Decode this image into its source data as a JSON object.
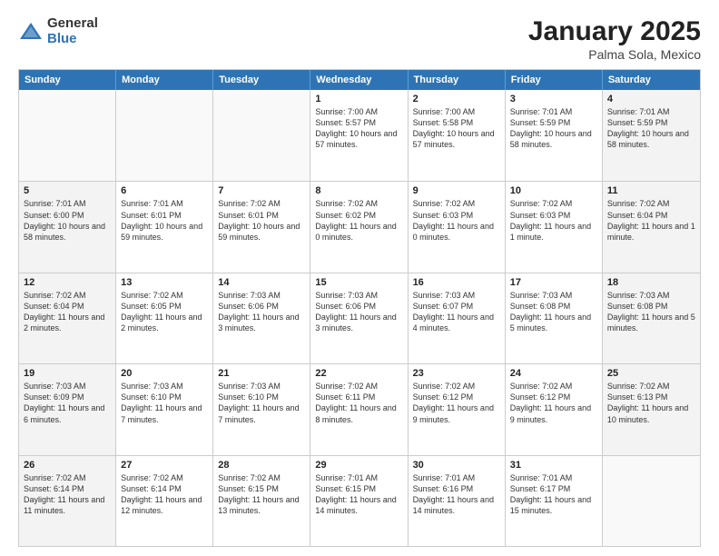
{
  "logo": {
    "general": "General",
    "blue": "Blue"
  },
  "title": "January 2025",
  "subtitle": "Palma Sola, Mexico",
  "header_days": [
    "Sunday",
    "Monday",
    "Tuesday",
    "Wednesday",
    "Thursday",
    "Friday",
    "Saturday"
  ],
  "rows": [
    [
      {
        "day": "",
        "info": "",
        "empty": true
      },
      {
        "day": "",
        "info": "",
        "empty": true
      },
      {
        "day": "",
        "info": "",
        "empty": true
      },
      {
        "day": "1",
        "info": "Sunrise: 7:00 AM\nSunset: 5:57 PM\nDaylight: 10 hours\nand 57 minutes."
      },
      {
        "day": "2",
        "info": "Sunrise: 7:00 AM\nSunset: 5:58 PM\nDaylight: 10 hours\nand 57 minutes."
      },
      {
        "day": "3",
        "info": "Sunrise: 7:01 AM\nSunset: 5:59 PM\nDaylight: 10 hours\nand 58 minutes."
      },
      {
        "day": "4",
        "info": "Sunrise: 7:01 AM\nSunset: 5:59 PM\nDaylight: 10 hours\nand 58 minutes.",
        "shaded": true
      }
    ],
    [
      {
        "day": "5",
        "info": "Sunrise: 7:01 AM\nSunset: 6:00 PM\nDaylight: 10 hours\nand 58 minutes.",
        "shaded": true
      },
      {
        "day": "6",
        "info": "Sunrise: 7:01 AM\nSunset: 6:01 PM\nDaylight: 10 hours\nand 59 minutes."
      },
      {
        "day": "7",
        "info": "Sunrise: 7:02 AM\nSunset: 6:01 PM\nDaylight: 10 hours\nand 59 minutes."
      },
      {
        "day": "8",
        "info": "Sunrise: 7:02 AM\nSunset: 6:02 PM\nDaylight: 11 hours\nand 0 minutes."
      },
      {
        "day": "9",
        "info": "Sunrise: 7:02 AM\nSunset: 6:03 PM\nDaylight: 11 hours\nand 0 minutes."
      },
      {
        "day": "10",
        "info": "Sunrise: 7:02 AM\nSunset: 6:03 PM\nDaylight: 11 hours\nand 1 minute."
      },
      {
        "day": "11",
        "info": "Sunrise: 7:02 AM\nSunset: 6:04 PM\nDaylight: 11 hours\nand 1 minute.",
        "shaded": true
      }
    ],
    [
      {
        "day": "12",
        "info": "Sunrise: 7:02 AM\nSunset: 6:04 PM\nDaylight: 11 hours\nand 2 minutes.",
        "shaded": true
      },
      {
        "day": "13",
        "info": "Sunrise: 7:02 AM\nSunset: 6:05 PM\nDaylight: 11 hours\nand 2 minutes."
      },
      {
        "day": "14",
        "info": "Sunrise: 7:03 AM\nSunset: 6:06 PM\nDaylight: 11 hours\nand 3 minutes."
      },
      {
        "day": "15",
        "info": "Sunrise: 7:03 AM\nSunset: 6:06 PM\nDaylight: 11 hours\nand 3 minutes."
      },
      {
        "day": "16",
        "info": "Sunrise: 7:03 AM\nSunset: 6:07 PM\nDaylight: 11 hours\nand 4 minutes."
      },
      {
        "day": "17",
        "info": "Sunrise: 7:03 AM\nSunset: 6:08 PM\nDaylight: 11 hours\nand 5 minutes."
      },
      {
        "day": "18",
        "info": "Sunrise: 7:03 AM\nSunset: 6:08 PM\nDaylight: 11 hours\nand 5 minutes.",
        "shaded": true
      }
    ],
    [
      {
        "day": "19",
        "info": "Sunrise: 7:03 AM\nSunset: 6:09 PM\nDaylight: 11 hours\nand 6 minutes.",
        "shaded": true
      },
      {
        "day": "20",
        "info": "Sunrise: 7:03 AM\nSunset: 6:10 PM\nDaylight: 11 hours\nand 7 minutes."
      },
      {
        "day": "21",
        "info": "Sunrise: 7:03 AM\nSunset: 6:10 PM\nDaylight: 11 hours\nand 7 minutes."
      },
      {
        "day": "22",
        "info": "Sunrise: 7:02 AM\nSunset: 6:11 PM\nDaylight: 11 hours\nand 8 minutes."
      },
      {
        "day": "23",
        "info": "Sunrise: 7:02 AM\nSunset: 6:12 PM\nDaylight: 11 hours\nand 9 minutes."
      },
      {
        "day": "24",
        "info": "Sunrise: 7:02 AM\nSunset: 6:12 PM\nDaylight: 11 hours\nand 9 minutes."
      },
      {
        "day": "25",
        "info": "Sunrise: 7:02 AM\nSunset: 6:13 PM\nDaylight: 11 hours\nand 10 minutes.",
        "shaded": true
      }
    ],
    [
      {
        "day": "26",
        "info": "Sunrise: 7:02 AM\nSunset: 6:14 PM\nDaylight: 11 hours\nand 11 minutes.",
        "shaded": true
      },
      {
        "day": "27",
        "info": "Sunrise: 7:02 AM\nSunset: 6:14 PM\nDaylight: 11 hours\nand 12 minutes."
      },
      {
        "day": "28",
        "info": "Sunrise: 7:02 AM\nSunset: 6:15 PM\nDaylight: 11 hours\nand 13 minutes."
      },
      {
        "day": "29",
        "info": "Sunrise: 7:01 AM\nSunset: 6:15 PM\nDaylight: 11 hours\nand 14 minutes."
      },
      {
        "day": "30",
        "info": "Sunrise: 7:01 AM\nSunset: 6:16 PM\nDaylight: 11 hours\nand 14 minutes."
      },
      {
        "day": "31",
        "info": "Sunrise: 7:01 AM\nSunset: 6:17 PM\nDaylight: 11 hours\nand 15 minutes."
      },
      {
        "day": "",
        "info": "",
        "empty": true
      }
    ]
  ]
}
